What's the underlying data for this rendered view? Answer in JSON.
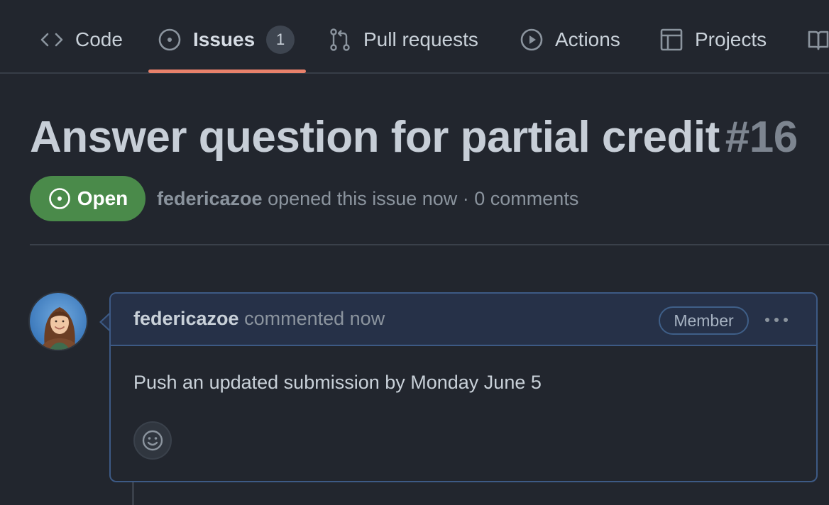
{
  "tabs": [
    {
      "label": "Code",
      "icon": "code-icon"
    },
    {
      "label": "Issues",
      "icon": "issue-opened-icon",
      "count": "1",
      "selected": true
    },
    {
      "label": "Pull requests",
      "icon": "git-pull-request-icon"
    },
    {
      "label": "Actions",
      "icon": "play-icon"
    },
    {
      "label": "Projects",
      "icon": "table-icon"
    },
    {
      "label": "",
      "icon": "book-icon"
    }
  ],
  "issue": {
    "title": "Answer question for partial credit",
    "number": "#16",
    "state": "Open",
    "author": "federicazoe",
    "meta_text": "opened this issue now · 0 comments"
  },
  "comment": {
    "author": "federicazoe",
    "action": "commented now",
    "role_badge": "Member",
    "body": "Push an updated submission by Monday June 5"
  },
  "colors": {
    "accent_underline": "#e8816b",
    "open_green": "#4a8a4a",
    "comment_border": "#3d5a85"
  }
}
